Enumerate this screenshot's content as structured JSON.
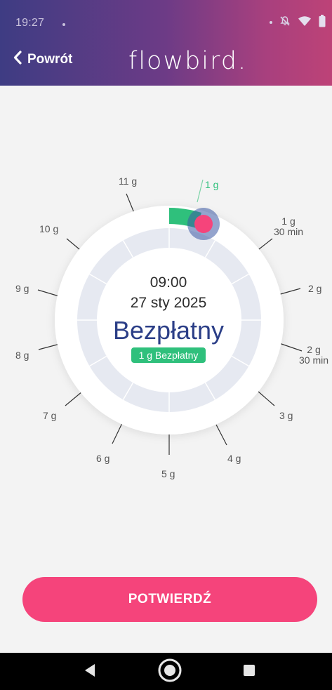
{
  "status_bar": {
    "time": "19:27",
    "icons": [
      "notification-dot-icon",
      "bell-off-icon",
      "wifi-icon",
      "battery-icon"
    ]
  },
  "nav": {
    "back_label": "Powrót",
    "brand": "flowbird."
  },
  "dial": {
    "labels": {
      "t11": "11 g",
      "t0": "1 g",
      "t1a": "1 g",
      "t1b": "30 min",
      "t2": "2 g",
      "t2a": "2 g",
      "t2b": "30 min",
      "t3": "3 g",
      "t4": "4 g",
      "t5": "5 g",
      "t6": "6 g",
      "t7": "7 g",
      "t8": "8 g",
      "t9": "9 g",
      "t10": "10 g"
    },
    "selected_value": "1 g",
    "colors": {
      "track": "#e6e9f1",
      "progress": "#2fc07c",
      "handle": "#f5447b",
      "handle_ring": "#3d5aa4"
    }
  },
  "summary": {
    "time": "09:00",
    "date": "27 sty 2025",
    "tariff": "Bezpłatny",
    "badge": "1 g Bezpłatny"
  },
  "actions": {
    "confirm_label": "POTWIERDŹ"
  },
  "system_nav": {
    "icons": [
      "back-triangle-icon",
      "home-circle-icon",
      "recents-square-icon"
    ]
  }
}
